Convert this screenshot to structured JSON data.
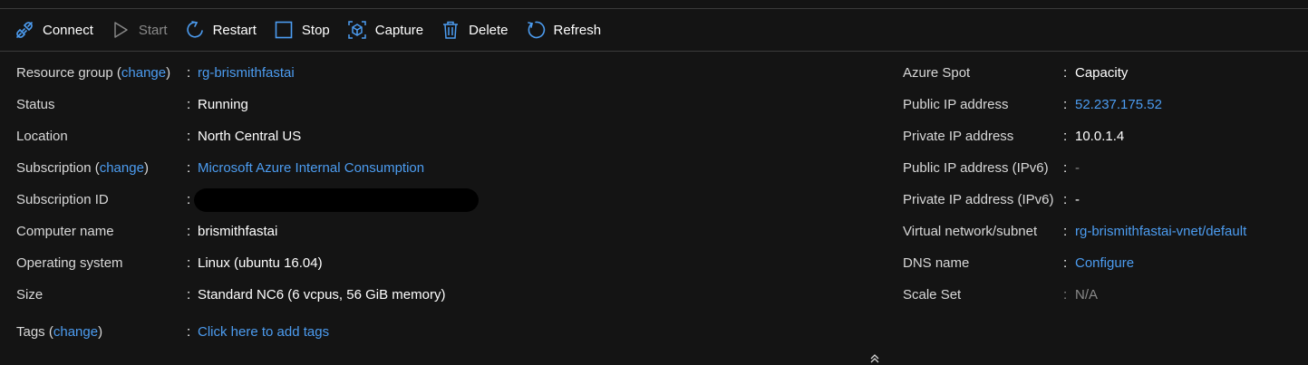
{
  "toolbar": {
    "connect": "Connect",
    "start": "Start",
    "restart": "Restart",
    "stop": "Stop",
    "capture": "Capture",
    "delete": "Delete",
    "refresh": "Refresh"
  },
  "left": {
    "resource_group": {
      "label_pre": "Resource group (",
      "change": "change",
      "label_post": ")",
      "value": "rg-brismithfastai"
    },
    "status": {
      "label": "Status",
      "value": "Running"
    },
    "location": {
      "label": "Location",
      "value": "North Central US"
    },
    "subscription": {
      "label_pre": "Subscription (",
      "change": "change",
      "label_post": ")",
      "value": "Microsoft Azure Internal Consumption"
    },
    "subscription_id": {
      "label": "Subscription ID"
    },
    "computer_name": {
      "label": "Computer name",
      "value": "brismithfastai"
    },
    "os": {
      "label": "Operating system",
      "value": "Linux (ubuntu 16.04)"
    },
    "size": {
      "label": "Size",
      "value": "Standard NC6 (6 vcpus, 56 GiB memory)"
    },
    "tags": {
      "label_pre": "Tags (",
      "change": "change",
      "label_post": ")",
      "value": "Click here to add tags"
    }
  },
  "right": {
    "azure_spot": {
      "label": "Azure Spot",
      "value": "Capacity"
    },
    "public_ip": {
      "label": "Public IP address",
      "value": "52.237.175.52"
    },
    "private_ip": {
      "label": "Private IP address",
      "value": "10.0.1.4"
    },
    "public_ipv6": {
      "label": "Public IP address (IPv6)",
      "value": "-"
    },
    "private_ipv6": {
      "label": "Private IP address (IPv6)",
      "value": "-"
    },
    "vnet": {
      "label": "Virtual network/subnet",
      "value": "rg-brismithfastai-vnet/default"
    },
    "dns": {
      "label": "DNS name",
      "value": "Configure"
    },
    "scale_set": {
      "label": "Scale Set",
      "value": "N/A"
    }
  },
  "separator": ":",
  "colors": {
    "background": "#141414",
    "link": "#4c9cf0",
    "icon": "#4c9cf0",
    "disabled": "#8a8a8a"
  }
}
